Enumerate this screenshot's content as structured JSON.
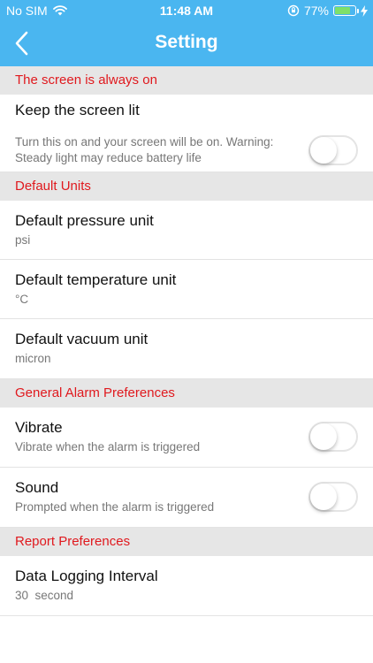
{
  "status_bar": {
    "carrier": "No SIM",
    "time": "11:48 AM",
    "battery_percent": "77%",
    "battery_level": 0.77
  },
  "nav": {
    "title": "Setting",
    "back_icon": "chevron-left-icon"
  },
  "sections": {
    "screen": {
      "header": "The screen is always on",
      "keep_lit": {
        "title": "Keep the screen lit",
        "subtitle_line1": "Turn this on and your screen will be on. Warning:",
        "subtitle_line2": "Steady light may reduce battery life",
        "enabled": false
      }
    },
    "units": {
      "header": "Default Units",
      "pressure": {
        "title": "Default pressure unit",
        "value": "psi"
      },
      "temperature": {
        "title": "Default temperature unit",
        "value": "°C"
      },
      "vacuum": {
        "title": "Default vacuum unit",
        "value": "micron"
      }
    },
    "alarm": {
      "header": "General Alarm Preferences",
      "vibrate": {
        "title": "Vibrate",
        "subtitle": "Vibrate when the alarm is triggered",
        "enabled": false
      },
      "sound": {
        "title": "Sound",
        "subtitle": "Prompted when the alarm is triggered",
        "enabled": false
      }
    },
    "report": {
      "header": "Report Preferences",
      "interval": {
        "title": "Data Logging Interval",
        "value": "30  second"
      }
    }
  },
  "colors": {
    "header_bg": "#4ab6f0",
    "section_text": "#e0191e",
    "section_bg": "#e6e6e6"
  }
}
